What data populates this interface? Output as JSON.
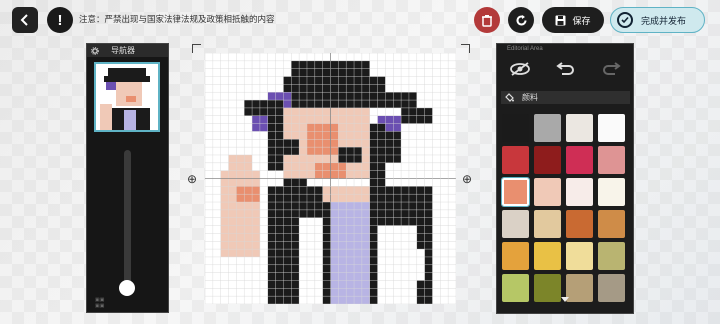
{
  "notice": "注意：严禁出现与国家法律法规及政策相抵触的内容",
  "toolbar": {
    "save_label": "保存",
    "publish_label": "完成并发布"
  },
  "navigator": {
    "title": "导航器",
    "zoom_level": 0.08
  },
  "palette": {
    "header": "Editorial Area",
    "tab_label": "颜料",
    "colors": [
      "#1b1b1b",
      "#a9a9a9",
      "#ebe7e1",
      "#fafafa",
      "#c8373c",
      "#8e1c1c",
      "#cf2e55",
      "#de9494",
      "#e98f6f",
      "#f0c9b7",
      "#f7ece9",
      "#f8f4ea",
      "#dad1c6",
      "#e2c99e",
      "#c96a32",
      "#cf8c48",
      "#e4a23c",
      "#e9c145",
      "#f0dd9a",
      "#b9b471",
      "#b6c766",
      "#7c8529",
      "#b59f77",
      "#a59a86"
    ],
    "selected_index": 8
  },
  "colors": {
    "accent": "#5fb3c5",
    "danger": "#b33a3a",
    "dark": "#1e1e1e"
  }
}
